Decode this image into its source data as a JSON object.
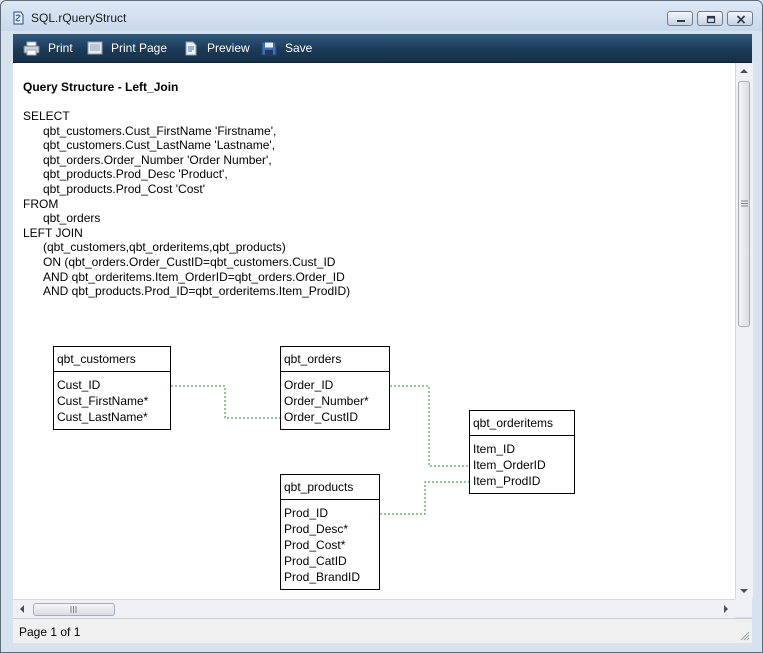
{
  "window": {
    "title": "SQL.rQueryStruct"
  },
  "toolbar": {
    "print_label": "Print",
    "print_page_label": "Print Page",
    "preview_label": "Preview",
    "save_label": "Save"
  },
  "report": {
    "heading": "Query Structure - Left_Join",
    "sql": {
      "select_kw": "SELECT",
      "select_cols": [
        "qbt_customers.Cust_FirstName 'Firstname',",
        "qbt_customers.Cust_LastName 'Lastname',",
        "qbt_orders.Order_Number 'Order Number',",
        "qbt_products.Prod_Desc 'Product',",
        "qbt_products.Prod_Cost 'Cost'"
      ],
      "from_kw": "FROM",
      "from_table": "qbt_orders",
      "join_kw": "LEFT JOIN",
      "join_lines": [
        "(qbt_customers,qbt_orderitems,qbt_products)",
        "ON (qbt_orders.Order_CustID=qbt_customers.Cust_ID",
        "AND qbt_orderitems.Item_OrderID=qbt_orders.Order_ID",
        "AND qbt_products.Prod_ID=qbt_orderitems.Item_ProdID)"
      ]
    },
    "tables": [
      {
        "name": "qbt_customers",
        "fields": [
          "Cust_ID",
          "Cust_FirstName*",
          "Cust_LastName*"
        ]
      },
      {
        "name": "qbt_orders",
        "fields": [
          "Order_ID",
          "Order_Number*",
          "Order_CustID"
        ]
      },
      {
        "name": "qbt_orderitems",
        "fields": [
          "Item_ID",
          "Item_OrderID",
          "Item_ProdID"
        ]
      },
      {
        "name": "qbt_products",
        "fields": [
          "Prod_ID",
          "Prod_Desc*",
          "Prod_Cost*",
          "Prod_CatID",
          "Prod_BrandID"
        ]
      }
    ],
    "link_color": "#2e8b2e"
  },
  "status": {
    "page_text": "Page 1 of 1"
  }
}
